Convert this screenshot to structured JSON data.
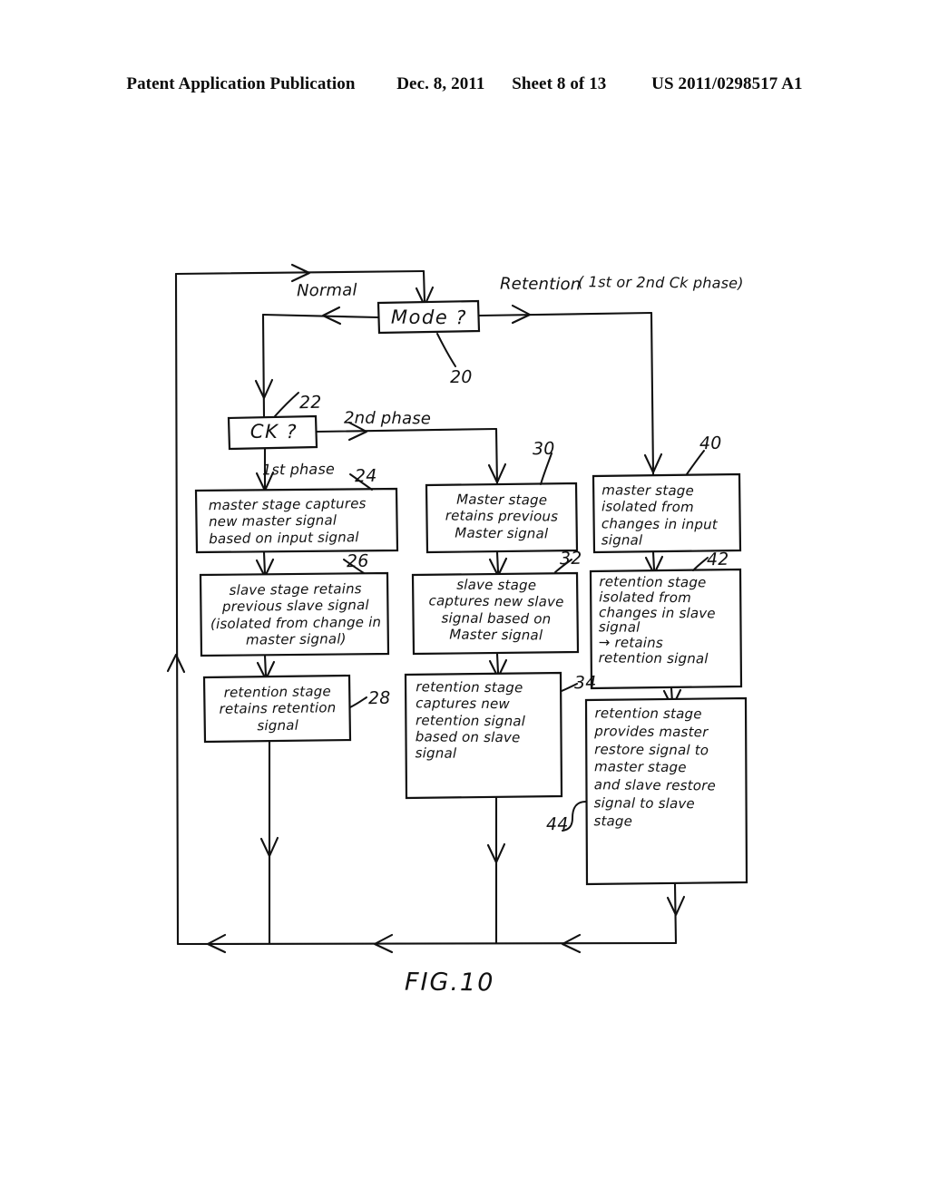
{
  "header": {
    "publication": "Patent Application Publication",
    "date": "Dec. 8, 2011",
    "sheet": "Sheet 8 of 13",
    "number": "US 2011/0298517 A1"
  },
  "figure": {
    "caption": "FIG.10",
    "ink_color": "#111111",
    "background_color": "#ffffff"
  },
  "decisions": [
    {
      "id": "mode",
      "label": "Mode ?",
      "ref": "20"
    },
    {
      "id": "ck",
      "label": "CK ?",
      "ref": "22"
    }
  ],
  "edge_labels": {
    "normal": "Normal",
    "retention": "Retention",
    "retention_note": "( 1st or 2nd Ck phase)",
    "second_phase": "2nd phase",
    "first_phase": "1st phase"
  },
  "boxes": [
    {
      "id": "box24",
      "ref": "24",
      "column": "normal-1st-phase",
      "text": "master stage captures\nnew master signal\nbased on input signal"
    },
    {
      "id": "box26",
      "ref": "26",
      "column": "normal-1st-phase",
      "text": "slave stage retains\nprevious slave signal\n(isolated from change in\nmaster signal)"
    },
    {
      "id": "box28",
      "ref": "28",
      "column": "normal-1st-phase",
      "text": "retention stage\nretains retention\nsignal"
    },
    {
      "id": "box30",
      "ref": "30",
      "column": "normal-2nd-phase",
      "text": "Master stage\nretains previous\nMaster signal"
    },
    {
      "id": "box32",
      "ref": "32",
      "column": "normal-2nd-phase",
      "text": "slave stage\ncaptures new slave\nsignal based on\nMaster signal"
    },
    {
      "id": "box34",
      "ref": "34",
      "column": "normal-2nd-phase",
      "text": "retention stage\ncaptures new\nretention signal\nbased on slave\nsignal"
    },
    {
      "id": "box40",
      "ref": "40",
      "column": "retention",
      "text": "master stage\nisolated from\nchanges in input\nsignal"
    },
    {
      "id": "box42",
      "ref": "42",
      "column": "retention",
      "text": "retention stage\nisolated from\nchanges in slave\nsignal\n→ retains\nretention signal"
    },
    {
      "id": "box44",
      "ref": "44",
      "column": "retention",
      "text": "retention stage\nprovides master\nrestore signal to\nmaster stage\nand slave restore\nsignal to slave\nstage"
    }
  ]
}
